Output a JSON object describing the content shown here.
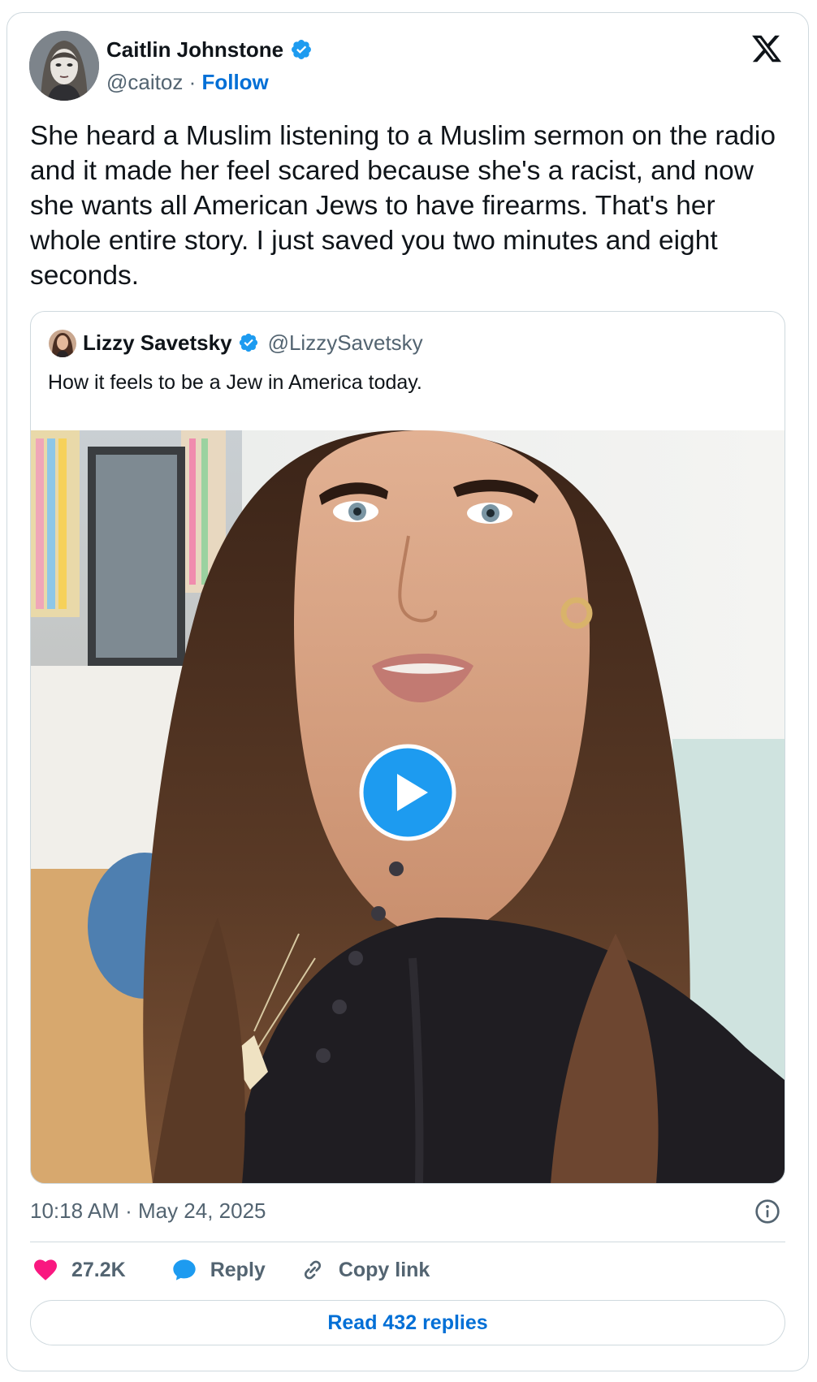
{
  "tweet": {
    "author": {
      "name": "Caitlin Johnstone",
      "handle": "@caitoz",
      "separator": "·",
      "follow_label": "Follow",
      "verified": true
    },
    "text": "She heard a Muslim listening to a Muslim sermon on the radio and it made her feel scared because she's a racist, and now she wants all American Jews to have firearms. That's her whole entire story. I just saved you two minutes and eight seconds.",
    "quoted": {
      "name": "Lizzy Savetsky",
      "handle": "@LizzySavetsky",
      "verified": true,
      "text": "How it feels to be a Jew in America today.",
      "media": {
        "type": "video",
        "icon": "play-icon"
      }
    },
    "timestamp": "10:18 AM · May 24, 2025",
    "actions": {
      "likes": "27.2K",
      "reply_label": "Reply",
      "copy_link_label": "Copy link"
    },
    "read_replies_label": "Read 432 replies"
  },
  "colors": {
    "brand_blue": "#006fd6",
    "verified_blue": "#1d9bf0",
    "like_red": "#f91880",
    "secondary_text": "#536471",
    "border": "#cfd9de"
  },
  "icons": [
    "verified-badge-icon",
    "x-logo-icon",
    "play-icon",
    "info-icon",
    "heart-icon",
    "reply-bubble-icon",
    "link-icon"
  ]
}
